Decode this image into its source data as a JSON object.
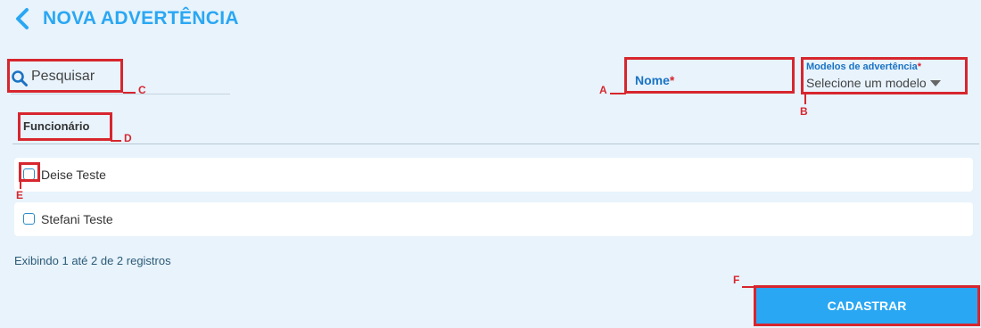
{
  "header": {
    "title": "NOVA ADVERTÊNCIA"
  },
  "search": {
    "placeholder": "Pesquisar"
  },
  "form": {
    "nome_label": "Nome",
    "required_mark": "*",
    "modelos_label": "Modelos de advertência",
    "modelos_selected": "Selecione um modelo"
  },
  "table": {
    "column_header": "Funcionário",
    "rows": [
      {
        "name": "Deise Teste",
        "checked": false
      },
      {
        "name": "Stefani Teste",
        "checked": false
      }
    ]
  },
  "footer": {
    "records_text": "Exibindo 1 até 2 de 2 registros"
  },
  "actions": {
    "submit_label": "CADASTRAR"
  },
  "annotations": {
    "a": "A",
    "b": "B",
    "c": "C",
    "d": "D",
    "e": "E",
    "f": "F"
  },
  "colors": {
    "accent": "#2aa7f3",
    "annotation": "#d7262e",
    "background": "#e8f3fc"
  }
}
